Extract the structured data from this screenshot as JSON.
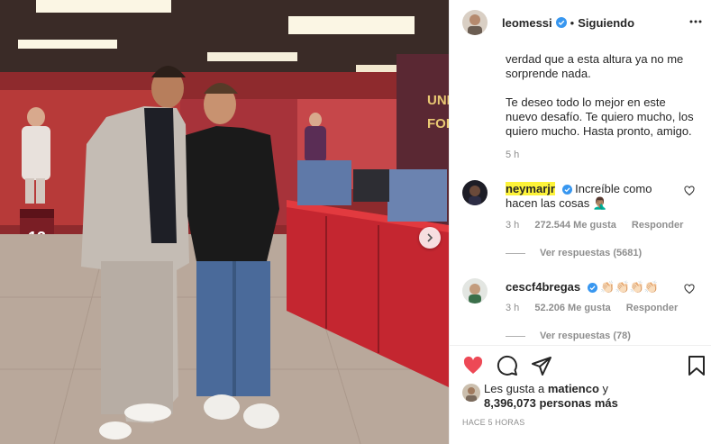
{
  "post": {
    "username": "leomessi",
    "separator": "•",
    "follow_status": "Siguiendo",
    "caption_lines": [
      "verdad que a esta altura ya no me sorprende nada.",
      "Te deseo todo lo mejor en este nuevo desafío. Te quiero mucho, los quiero mucho. Hasta pronto, amigo."
    ],
    "caption_time": "5 h",
    "photo_text": {
      "locker_number": "13",
      "wall_text_1": "UNI",
      "wall_text_2": "FOR"
    }
  },
  "comments": [
    {
      "user": "neymarjr",
      "text": "Increíble como hacen las cosas 🤦🏽‍♂️",
      "time": "3 h",
      "likes": "272.544 Me gusta",
      "reply": "Responder",
      "view_replies": "Ver respuestas (5681)"
    },
    {
      "user": "cescf4bregas",
      "text": "👏🏻👏🏻👏🏻👏🏻",
      "time": "3 h",
      "likes": "52.206 Me gusta",
      "reply": "Responder",
      "view_replies": "Ver respuestas (78)"
    }
  ],
  "likes_section": {
    "prefix": "Les gusta a ",
    "user": "matienco",
    "suffix": " y",
    "count": "8,396,073 personas más"
  },
  "timestamp": "Hace 5 horas",
  "colors": {
    "verified_blue": "#3897f0",
    "like_red": "#ed4956",
    "highlight": "#fdf33a"
  },
  "icons": [
    "verified-icon",
    "more-icon",
    "heart-icon",
    "comment-icon",
    "share-icon",
    "save-icon",
    "chevron-right-icon"
  ]
}
